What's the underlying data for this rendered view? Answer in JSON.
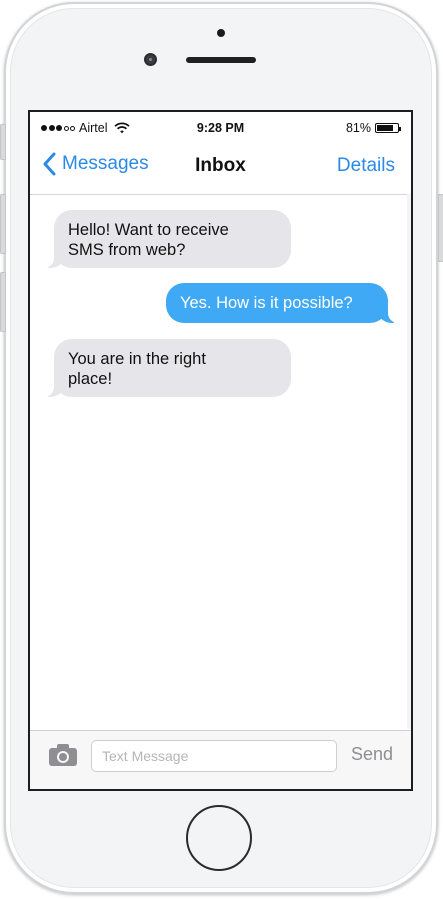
{
  "status_bar": {
    "carrier": "Airtel",
    "time": "9:28 PM",
    "battery_text": "81%",
    "battery_level": 0.81,
    "signal_bars_filled": 3,
    "signal_bars_total": 5
  },
  "nav": {
    "back_label": "Messages",
    "title": "Inbox",
    "details_label": "Details"
  },
  "messages": [
    {
      "direction": "incoming",
      "line1": "Hello! Want to receive",
      "line2": "SMS from web?"
    },
    {
      "direction": "outgoing",
      "line1": "Yes. How is it possible?"
    },
    {
      "direction": "incoming",
      "line1": "You are in the right",
      "line2": "place!"
    }
  ],
  "composer": {
    "placeholder": "Text Message",
    "value": "",
    "send_label": "Send"
  },
  "colors": {
    "accent": "#2a8ae6",
    "outgoing_bubble": "#3fa9f5",
    "incoming_bubble": "#e5e5ea"
  }
}
